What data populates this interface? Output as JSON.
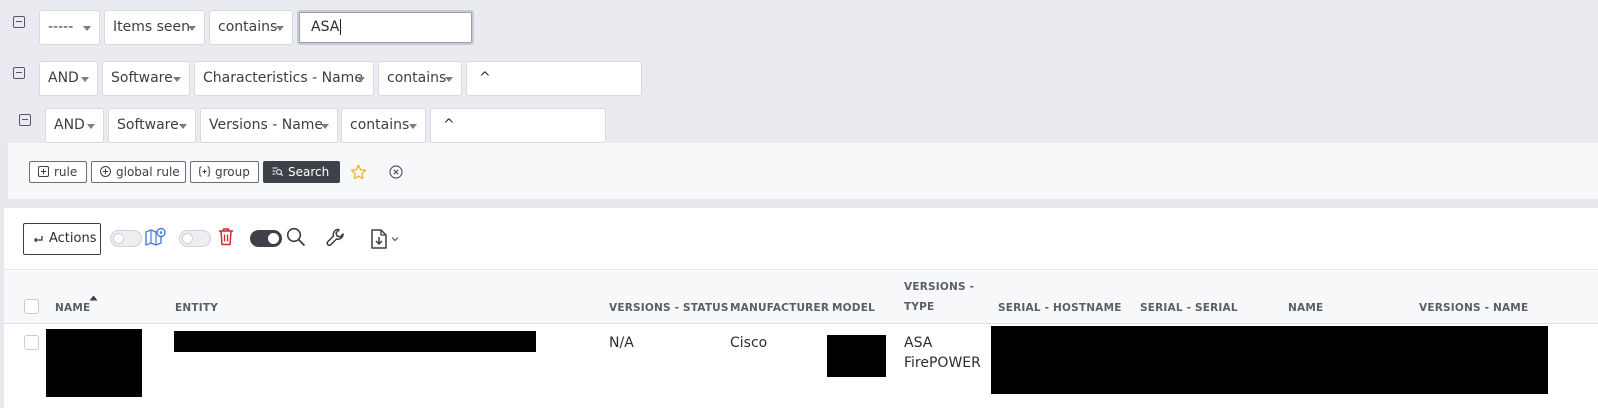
{
  "criteria": [
    {
      "link": "-----",
      "field": "Items seen",
      "operator": "contains",
      "value": "ASA"
    },
    {
      "link": "AND",
      "itemtype": "Software",
      "field": "Characteristics - Name",
      "operator": "contains",
      "value": "^"
    },
    {
      "link": "AND",
      "itemtype": "Software",
      "field": "Versions - Name",
      "operator": "contains",
      "value": "^"
    }
  ],
  "search_buttons": {
    "rule": "rule",
    "global_rule": "global rule",
    "group": "group",
    "search": "Search"
  },
  "colors": {
    "accent_dark": "#3f4148",
    "star": "#f0b429",
    "map_icon": "#4a7fd1",
    "trash_icon": "#d02b2b"
  },
  "toolbar": {
    "actions_label": "Actions",
    "toggle_map": false,
    "toggle_trash": false,
    "toggle_search": true
  },
  "table": {
    "columns": [
      "NAME",
      "ENTITY",
      "VERSIONS - STATUS",
      "MANUFACTURER",
      "MODEL",
      "VERSIONS -",
      "TYPE",
      "SERIAL - HOSTNAME",
      "SERIAL - SERIAL",
      "NAME",
      "VERSIONS - NAME"
    ],
    "sorted_column": "NAME",
    "rows": [
      {
        "versions_status": "N/A",
        "manufacturer": "Cisco",
        "versions_type_line1": "ASA",
        "versions_type_line2": "FirePOWER"
      }
    ]
  }
}
